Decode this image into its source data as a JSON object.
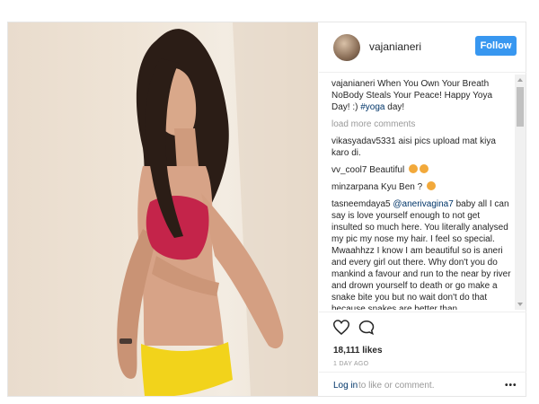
{
  "post": {
    "username": "vajanianeri",
    "follow_label": "Follow",
    "caption": {
      "user": "vajanianeri",
      "text": "When You Own Your Breath NoBody Steals Your Peace! Happy Yoya Day! :) ",
      "hashtag": "#yoga",
      "tail": " day!"
    },
    "load_more": "load more comments",
    "comments": [
      {
        "user": "vikasyadav5331",
        "text": " aisi pics upload mat kiya karo di."
      },
      {
        "user": "vv_cool7",
        "text": " Beautiful "
      },
      {
        "user": "minzarpana",
        "text": " Kyu Ben ? "
      },
      {
        "user": "tasneemdaya5",
        "mention": "@anerivagina7",
        "text": " baby all I can say is love yourself enough to not get insulted so much here. You literally analysed my pic my nose my hair. I feel so special. Mwaahhzz I know I am beautiful so is aneri and every girl out there. Why don't you do mankind a favour and run to the near by river and drown yourself to death or go make a snake bite you but no wait don't do that because snakes are better than"
      }
    ],
    "likes": "18,111 likes",
    "timestamp": "1 DAY AGO",
    "login_link": "Log in",
    "login_text": " to like or comment.",
    "more_label": "•••"
  },
  "icons": {
    "heart": "heart-icon",
    "comment": "comment-bubble-icon"
  },
  "colors": {
    "follow_button": "#3897f0",
    "link": "#003569",
    "muted": "#999999",
    "top_garment": "#c4244a",
    "bottom_garment": "#f2d31b"
  }
}
